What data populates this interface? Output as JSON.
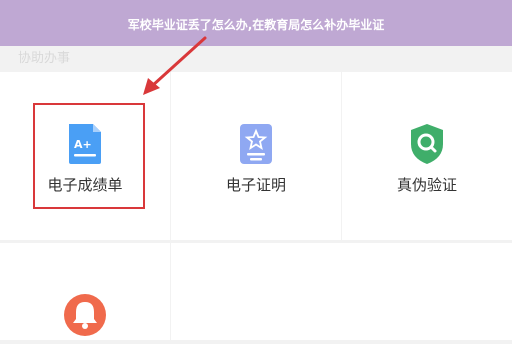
{
  "banner": {
    "title": "军校毕业证丢了怎么办,在教育局怎么补办毕业证"
  },
  "section": {
    "label": "协助办事"
  },
  "services": [
    {
      "label": "电子成绩单",
      "icon": "transcript-icon",
      "color": "#4a9ff5"
    },
    {
      "label": "电子证明",
      "icon": "certificate-icon",
      "color": "#8fa8f2"
    },
    {
      "label": "真伪验证",
      "icon": "verify-shield-icon",
      "color": "#3fae6a"
    },
    {
      "label": "",
      "icon": "bell-icon",
      "color": "#f06a4c"
    }
  ],
  "annotation": {
    "highlight_color": "#d9383a"
  }
}
